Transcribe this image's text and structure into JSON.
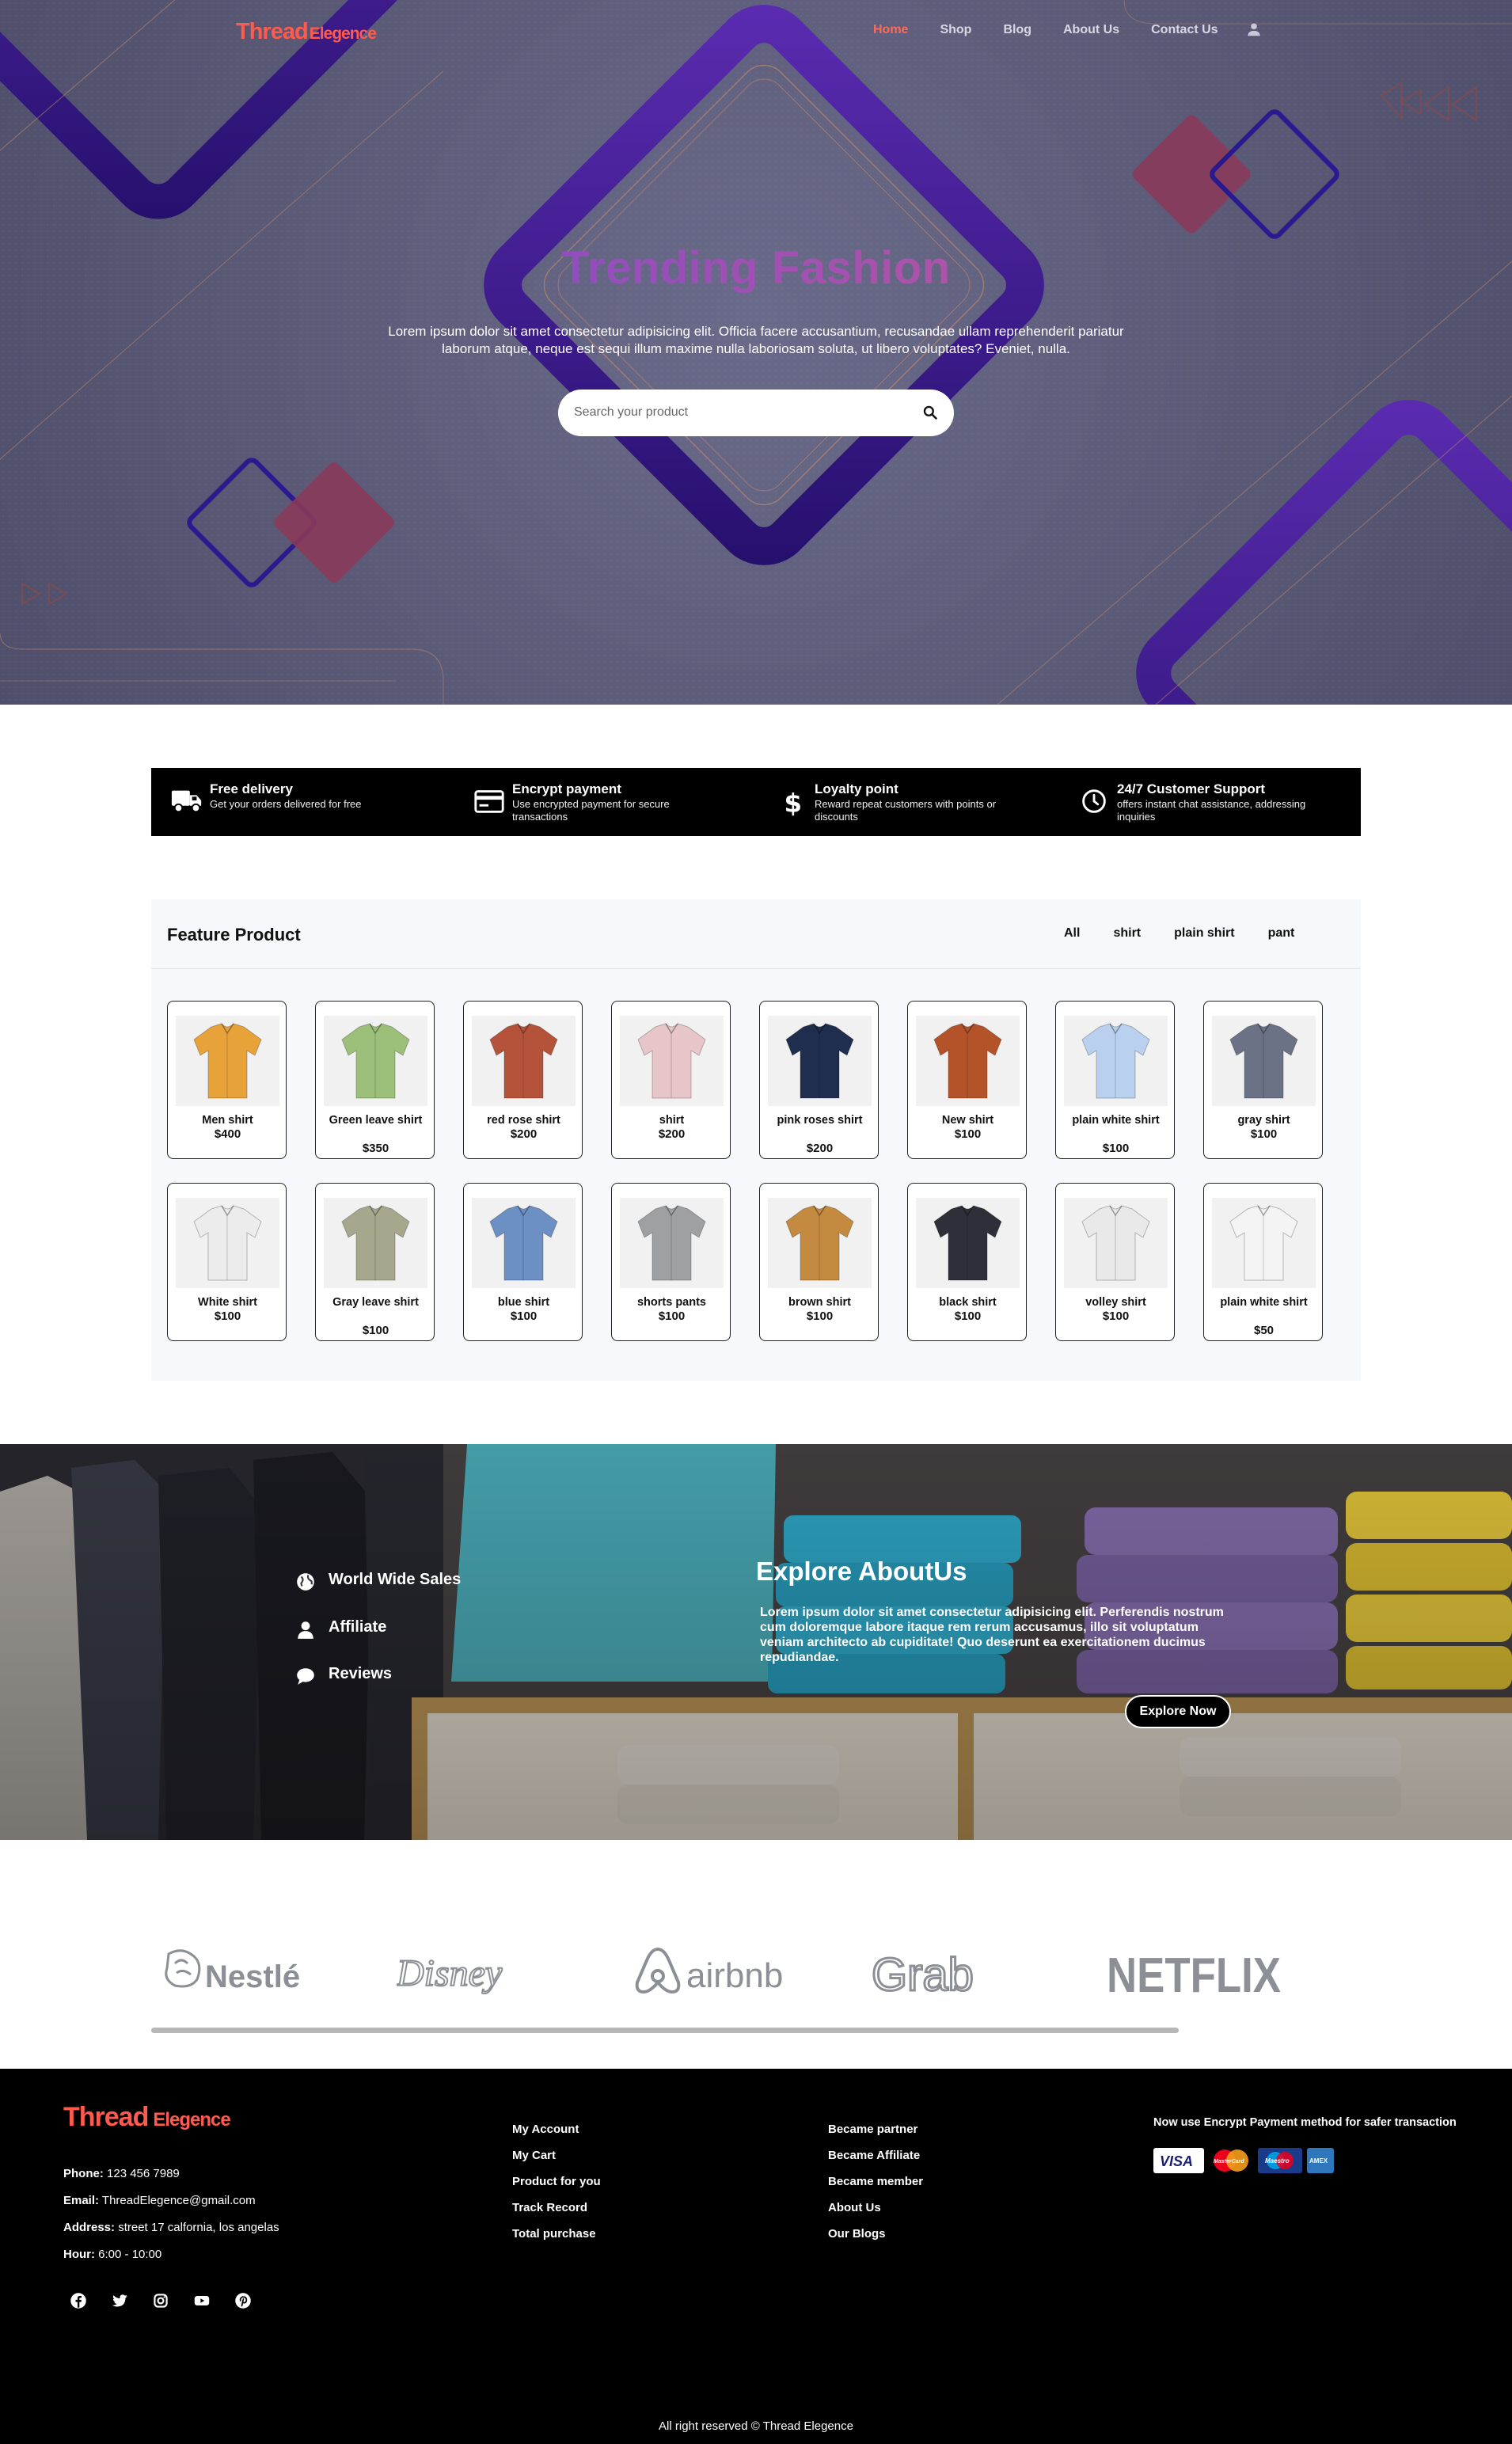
{
  "brand": {
    "name_part1": "Thread",
    "name_part2": "Elegence"
  },
  "nav": {
    "items": [
      {
        "label": "Home",
        "active": true
      },
      {
        "label": "Shop",
        "active": false
      },
      {
        "label": "Blog",
        "active": false
      },
      {
        "label": "About Us",
        "active": false
      },
      {
        "label": "Contact Us",
        "active": false
      }
    ],
    "user_icon": "user-icon"
  },
  "hero": {
    "title": "Trending Fashion",
    "text": "Lorem ipsum dolor sit amet consectetur adipisicing elit. Officia facere accusantium, recusandae ullam reprehenderit pariatur laborum atque, neque est sequi illum maxime nulla laboriosam soluta, ut libero voluptates? Eveniet, nulla.",
    "search_placeholder": "Search your product",
    "search_icon": "search-icon"
  },
  "services": [
    {
      "icon": "truck-icon",
      "title": "Free delivery",
      "desc": "Get your orders delivered for free"
    },
    {
      "icon": "credit-card-icon",
      "title": "Encrypt payment",
      "desc": "Use encrypted payment for secure transactions"
    },
    {
      "icon": "dollar-icon",
      "title": "Loyalty point",
      "desc": "Reward repeat customers with points or discounts"
    },
    {
      "icon": "clock-icon",
      "title": "24/7 Customer Support",
      "desc": "offers instant chat assistance, addressing inquiries"
    }
  ],
  "feature": {
    "title": "Feature Product",
    "filters": [
      "All",
      "shirt",
      "plain shirt",
      "pant"
    ],
    "products": [
      {
        "name": "Men shirt",
        "price": "$400",
        "color": "#e8a23a"
      },
      {
        "name": "Green leave shirt",
        "price": "$350",
        "color": "#9cbf7a"
      },
      {
        "name": "red rose shirt",
        "price": "$200",
        "color": "#b5533a"
      },
      {
        "name": "shirt",
        "price": "$200",
        "color": "#e7c6c9"
      },
      {
        "name": "pink roses shirt",
        "price": "$200",
        "color": "#1f2d4f"
      },
      {
        "name": "New shirt",
        "price": "$100",
        "color": "#b4532a"
      },
      {
        "name": "plain white shirt",
        "price": "$100",
        "color": "#b9d0ee"
      },
      {
        "name": "gray shirt",
        "price": "$100",
        "color": "#6b7286"
      },
      {
        "name": "White shirt",
        "price": "$100",
        "color": "#ececec"
      },
      {
        "name": "Gray leave shirt",
        "price": "$100",
        "color": "#a6a78d"
      },
      {
        "name": "blue shirt",
        "price": "$100",
        "color": "#6c8fc4"
      },
      {
        "name": "shorts pants",
        "price": "$100",
        "color": "#9fa0a2"
      },
      {
        "name": "brown shirt",
        "price": "$100",
        "color": "#c48a3f"
      },
      {
        "name": "black shirt",
        "price": "$100",
        "color": "#2e2f38"
      },
      {
        "name": "volley shirt",
        "price": "$100",
        "color": "#e9e9e9"
      },
      {
        "name": "plain white shirt",
        "price": "$50",
        "color": "#f4f4f4"
      }
    ]
  },
  "explore": {
    "items": [
      {
        "icon": "globe-icon",
        "label": "World Wide Sales"
      },
      {
        "icon": "user-icon",
        "label": "Affiliate"
      },
      {
        "icon": "chat-icon",
        "label": "Reviews"
      }
    ],
    "title": "Explore AboutUs",
    "text": "Lorem ipsum dolor sit amet consectetur adipisicing elit. Perferendis nostrum cum doloremque labore itaque rem rerum accusamus, illo sit voluptatum veniam architecto ab cupiditate! Quo deserunt ea exercitationem ducimus repudiandae.",
    "button": "Explore Now"
  },
  "brands": [
    "Nestlé",
    "Disney",
    "airbnb",
    "Grab",
    "NETFLIX"
  ],
  "footer": {
    "contact": [
      {
        "label": "Phone:",
        "value": "123 456 7989"
      },
      {
        "label": "Email:",
        "value": "ThreadElegence@gmail.com"
      },
      {
        "label": "Address:",
        "value": "street 17 calfornia, los angelas"
      },
      {
        "label": "Hour:",
        "value": "6:00 - 10:00"
      }
    ],
    "socials": [
      "facebook-icon",
      "twitter-icon",
      "instagram-icon",
      "youtube-icon",
      "pinterest-icon"
    ],
    "col1": [
      "My Account",
      "My Cart",
      "Product for you",
      "Track Record",
      "Total purchase"
    ],
    "col2": [
      "Became partner",
      "Became Affiliate",
      "Became member",
      "About Us",
      "Our Blogs"
    ],
    "payment_title": "Now use Encrypt Payment method for safer transaction",
    "cards": [
      "VISA",
      "MasterCard",
      "Maestro",
      "AMEX"
    ],
    "copyright": "All right reserved © Thread Elegence"
  },
  "colors": {
    "accent": "#ff5a4e",
    "hero_bg": "#5b5b78",
    "purple": "#3b1d8f",
    "dark": "#000000"
  }
}
